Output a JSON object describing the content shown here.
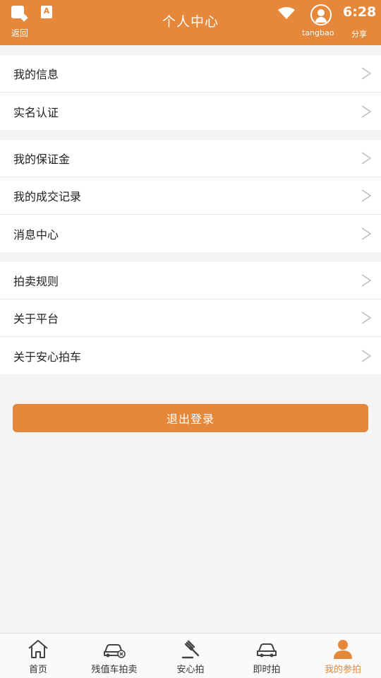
{
  "header": {
    "title": "个人中心",
    "back_label": "返回",
    "account_label": "tangbao",
    "share_label": "分享",
    "clock": "6:28",
    "a_badge": "A"
  },
  "menu_groups": [
    {
      "items": [
        {
          "label": "我的信息"
        },
        {
          "label": "实名认证"
        }
      ]
    },
    {
      "items": [
        {
          "label": "我的保证金"
        },
        {
          "label": "我的成交记录"
        },
        {
          "label": "消息中心"
        }
      ]
    },
    {
      "items": [
        {
          "label": "拍卖规则"
        },
        {
          "label": "关于平台"
        },
        {
          "label": "关于安心拍车"
        }
      ]
    }
  ],
  "logout": {
    "label": "退出登录"
  },
  "bottom_nav": {
    "items": [
      {
        "label": "首页",
        "icon": "home-icon"
      },
      {
        "label": "残值车拍卖",
        "icon": "car-cancel-icon"
      },
      {
        "label": "安心拍",
        "icon": "auction-hammer-icon"
      },
      {
        "label": "即时拍",
        "icon": "car-icon"
      },
      {
        "label": "我的参拍",
        "icon": "person-icon",
        "active": true
      }
    ]
  },
  "colors": {
    "accent": "#e6883b",
    "background": "#f4f4f4",
    "text": "#222222"
  }
}
